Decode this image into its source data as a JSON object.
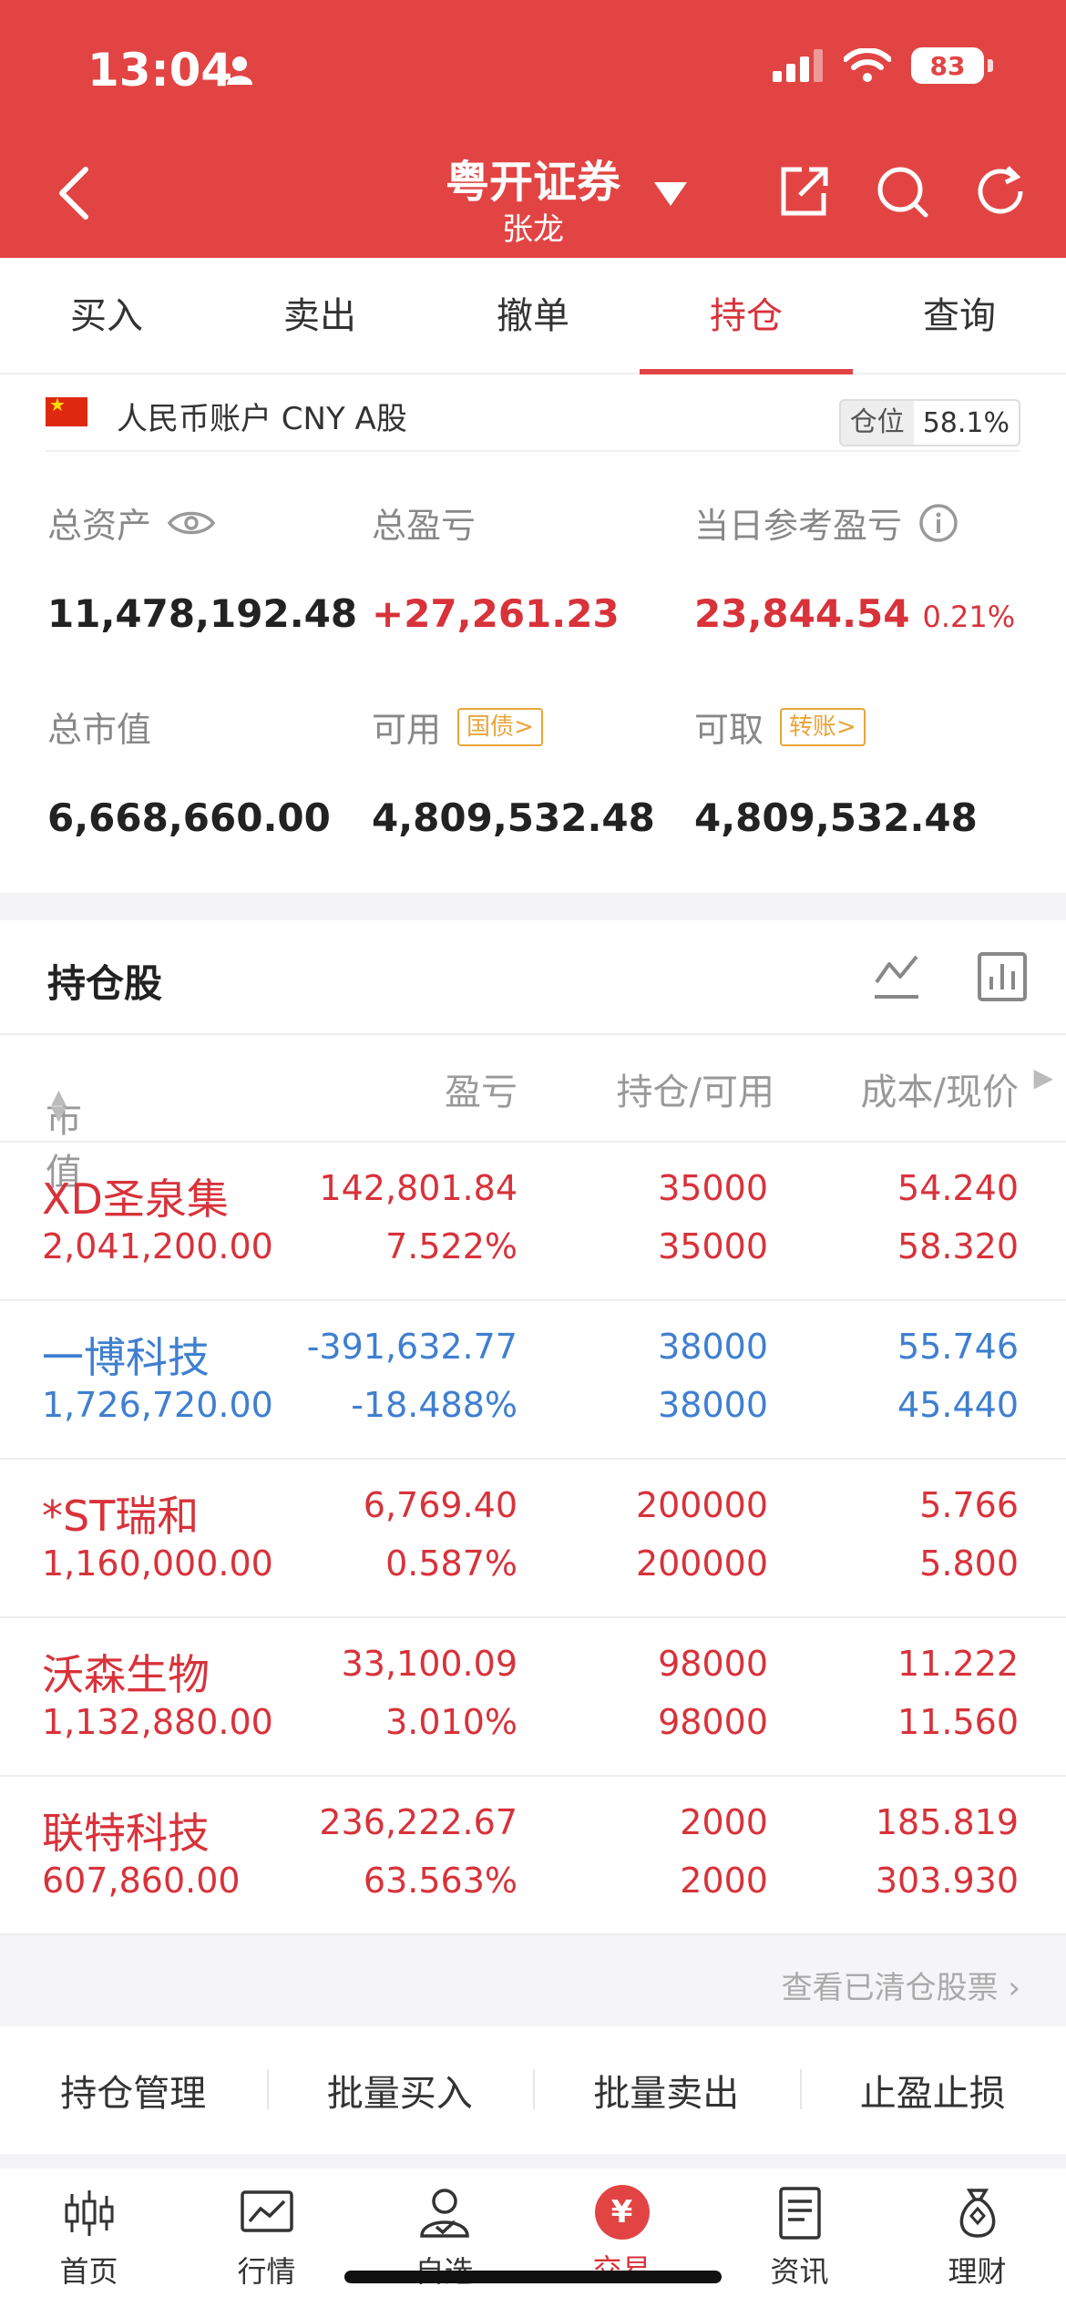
{
  "status": {
    "time": "13:04",
    "battery": "83"
  },
  "nav": {
    "title": "粤开证券",
    "subtitle": "张龙"
  },
  "trade_tabs": [
    {
      "label": "买入"
    },
    {
      "label": "卖出"
    },
    {
      "label": "撤单"
    },
    {
      "label": "持仓"
    },
    {
      "label": "查询"
    }
  ],
  "account": {
    "label": "人民币账户 CNY A股",
    "position_label": "仓位",
    "position_value": "58.1%"
  },
  "summary": {
    "total_assets_label": "总资产",
    "total_assets": "11,478,192.48",
    "total_pl_label": "总盈亏",
    "total_pl": "+27,261.23",
    "day_pl_label": "当日参考盈亏",
    "day_pl": "23,844.54",
    "day_pl_pct": "0.21%",
    "market_value_label": "总市值",
    "market_value": "6,668,660.00",
    "available_label": "可用",
    "available_tag": "国债",
    "available": "4,809,532.48",
    "withdrawable_label": "可取",
    "withdrawable_tag": "转账",
    "withdrawable": "4,809,532.48"
  },
  "holdings": {
    "title": "持仓股",
    "col_market_value": "市值",
    "col_pl": "盈亏",
    "col_hold": "持仓/可用",
    "col_cost": "成本/现价",
    "rows": [
      {
        "name": "XD圣泉集",
        "mv": "2,041,200.00",
        "pl": "142,801.84",
        "plp": "7.522%",
        "hold": "35000",
        "avail": "35000",
        "cost": "54.240",
        "price": "58.320",
        "tone": "red"
      },
      {
        "name": "一博科技",
        "mv": "1,726,720.00",
        "pl": "-391,632.77",
        "plp": "-18.488%",
        "hold": "38000",
        "avail": "38000",
        "cost": "55.746",
        "price": "45.440",
        "tone": "blue"
      },
      {
        "name": "*ST瑞和",
        "mv": "1,160,000.00",
        "pl": "6,769.40",
        "plp": "0.587%",
        "hold": "200000",
        "avail": "200000",
        "cost": "5.766",
        "price": "5.800",
        "tone": "red"
      },
      {
        "name": "沃森生物",
        "mv": "1,132,880.00",
        "pl": "33,100.09",
        "plp": "3.010%",
        "hold": "98000",
        "avail": "98000",
        "cost": "11.222",
        "price": "11.560",
        "tone": "red"
      },
      {
        "name": "联特科技",
        "mv": "607,860.00",
        "pl": "236,222.67",
        "plp": "63.563%",
        "hold": "2000",
        "avail": "2000",
        "cost": "185.819",
        "price": "303.930",
        "tone": "red"
      }
    ],
    "cleared_link": "查看已清仓股票"
  },
  "actions": [
    {
      "label": "持仓管理"
    },
    {
      "label": "批量买入"
    },
    {
      "label": "批量卖出"
    },
    {
      "label": "止盈止损"
    }
  ],
  "tabbar": [
    {
      "label": "首页"
    },
    {
      "label": "行情"
    },
    {
      "label": "自选"
    },
    {
      "label": "交易"
    },
    {
      "label": "资讯"
    },
    {
      "label": "理财"
    }
  ],
  "colors": {
    "brand": "#e24444",
    "up": "#d8323a",
    "down": "#3f7fd0",
    "tag": "#e8a43a"
  }
}
